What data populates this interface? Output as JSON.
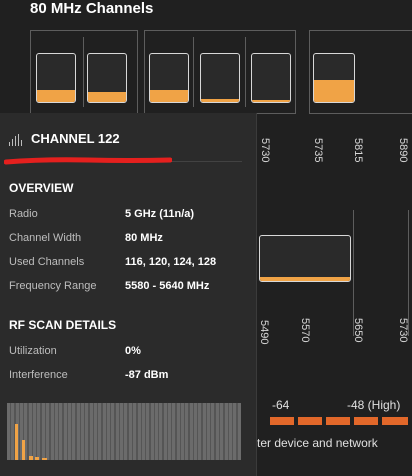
{
  "section": {
    "title": "80 MHz Channels"
  },
  "top_frequency_labels": [
    "5730",
    "5735",
    "5815",
    "5890"
  ],
  "lower_frequency_labels": [
    "5490",
    "5570",
    "5650",
    "5730"
  ],
  "bar_levels": {
    "group1": [
      0.25,
      0.2
    ],
    "group2": [
      0.25,
      0.0,
      0.05
    ],
    "group3": [
      0.45
    ],
    "selected": 0.1
  },
  "legend": {
    "mid": "-64",
    "high": "-48 (High)"
  },
  "footer_text": "ter device and network",
  "tooltip": {
    "title": "CHANNEL 122",
    "overview_heading": "OVERVIEW",
    "overview_rows": [
      {
        "label": "Radio",
        "value": "5 GHz (11n/a)"
      },
      {
        "label": "Channel Width",
        "value": "80 MHz"
      },
      {
        "label": "Used Channels",
        "value": "116, 120, 124, 128"
      },
      {
        "label": "Frequency Range",
        "value": "5580 - 5640 MHz"
      }
    ],
    "rf_heading": "RF SCAN DETAILS",
    "rf_rows": [
      {
        "label": "Utilization",
        "value": "0%"
      },
      {
        "label": "Interference",
        "value": "-87 dBm"
      }
    ]
  },
  "colors": {
    "background": "#202020",
    "panel": "#2b2b2b",
    "accent_orange": "#f0a346",
    "interference_red": "#e2682a",
    "annotation_red": "#e5201e"
  }
}
